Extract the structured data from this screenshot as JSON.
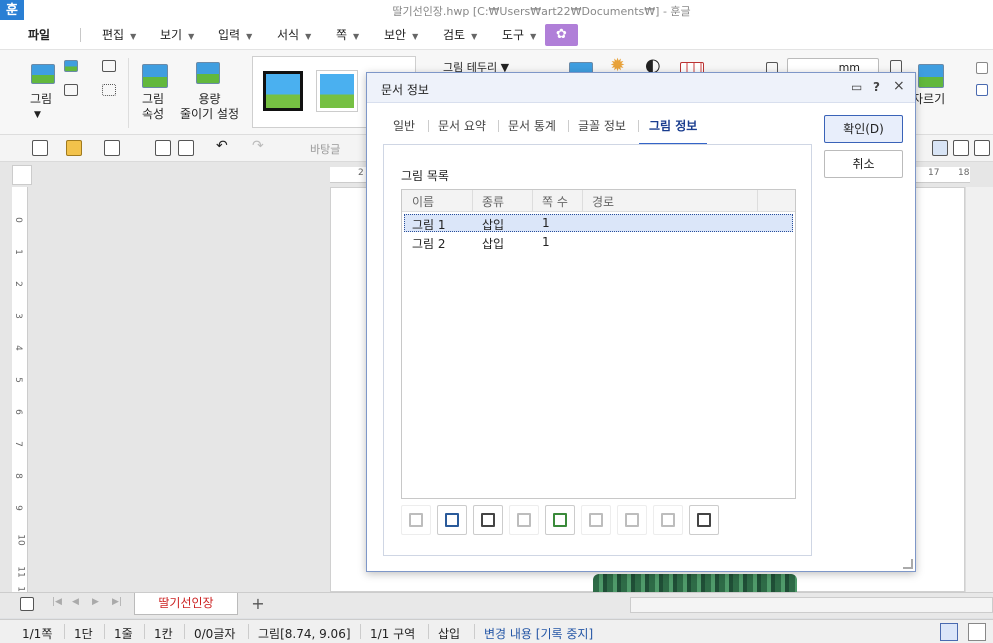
{
  "window": {
    "app_icon": "훈",
    "title": "딸기선인장.hwp [C:₩Users₩art22₩Documents₩] - 훈글"
  },
  "menu": {
    "file": "파일",
    "items": [
      "편집",
      "보기",
      "입력",
      "서식",
      "쪽",
      "보안",
      "검토",
      "도구"
    ],
    "special_icon": "tulip-icon"
  },
  "ribbon": {
    "picture": "그림",
    "picture_props": "그림\n속성",
    "reduce_size": "용량\n줄이기 설정",
    "border_label": "그림 테두리",
    "unit": "mm",
    "crop": "자르기"
  },
  "toolbar2": {
    "font_placeholder": "바탕글"
  },
  "ruler": {
    "h_ticks": [
      "2",
      "17",
      "18"
    ],
    "v_ticks": [
      "0",
      "1",
      "2",
      "3",
      "4",
      "5",
      "6",
      "7",
      "8",
      "9",
      "10",
      "11",
      "12"
    ]
  },
  "tabs": {
    "doc_tab": "딸기선인장",
    "add": "+"
  },
  "status": {
    "page": "1/1쪽",
    "column": "1단",
    "line": "1줄",
    "char": "1칸",
    "chars": "0/0글자",
    "object": "그림[8.74, 9.06]",
    "section": "1/1 구역",
    "mode": "삽입",
    "track": "변경 내용 [기록 중지]"
  },
  "dialog": {
    "title": "문서 정보",
    "help": "?",
    "close": "×",
    "tabs": [
      "일반",
      "문서 요약",
      "문서 통계",
      "글꼴 정보",
      "그림 정보"
    ],
    "active_tab": "그림 정보",
    "list_title": "그림 목록",
    "columns": [
      "이름",
      "종류",
      "쪽 수",
      "경로"
    ],
    "rows": [
      {
        "name": "그림 1",
        "type": "삽입",
        "page": "1",
        "path": ""
      },
      {
        "name": "그림 2",
        "type": "삽입",
        "page": "1",
        "path": ""
      }
    ],
    "ok": "확인(D)",
    "cancel": "취소",
    "action_icons": [
      "copy-out-icon",
      "save-as-icon",
      "extract-icon",
      "group-icon",
      "insert-picture-icon",
      "align-icon",
      "edit-icon",
      "duplicate-icon",
      "save-icon"
    ]
  }
}
